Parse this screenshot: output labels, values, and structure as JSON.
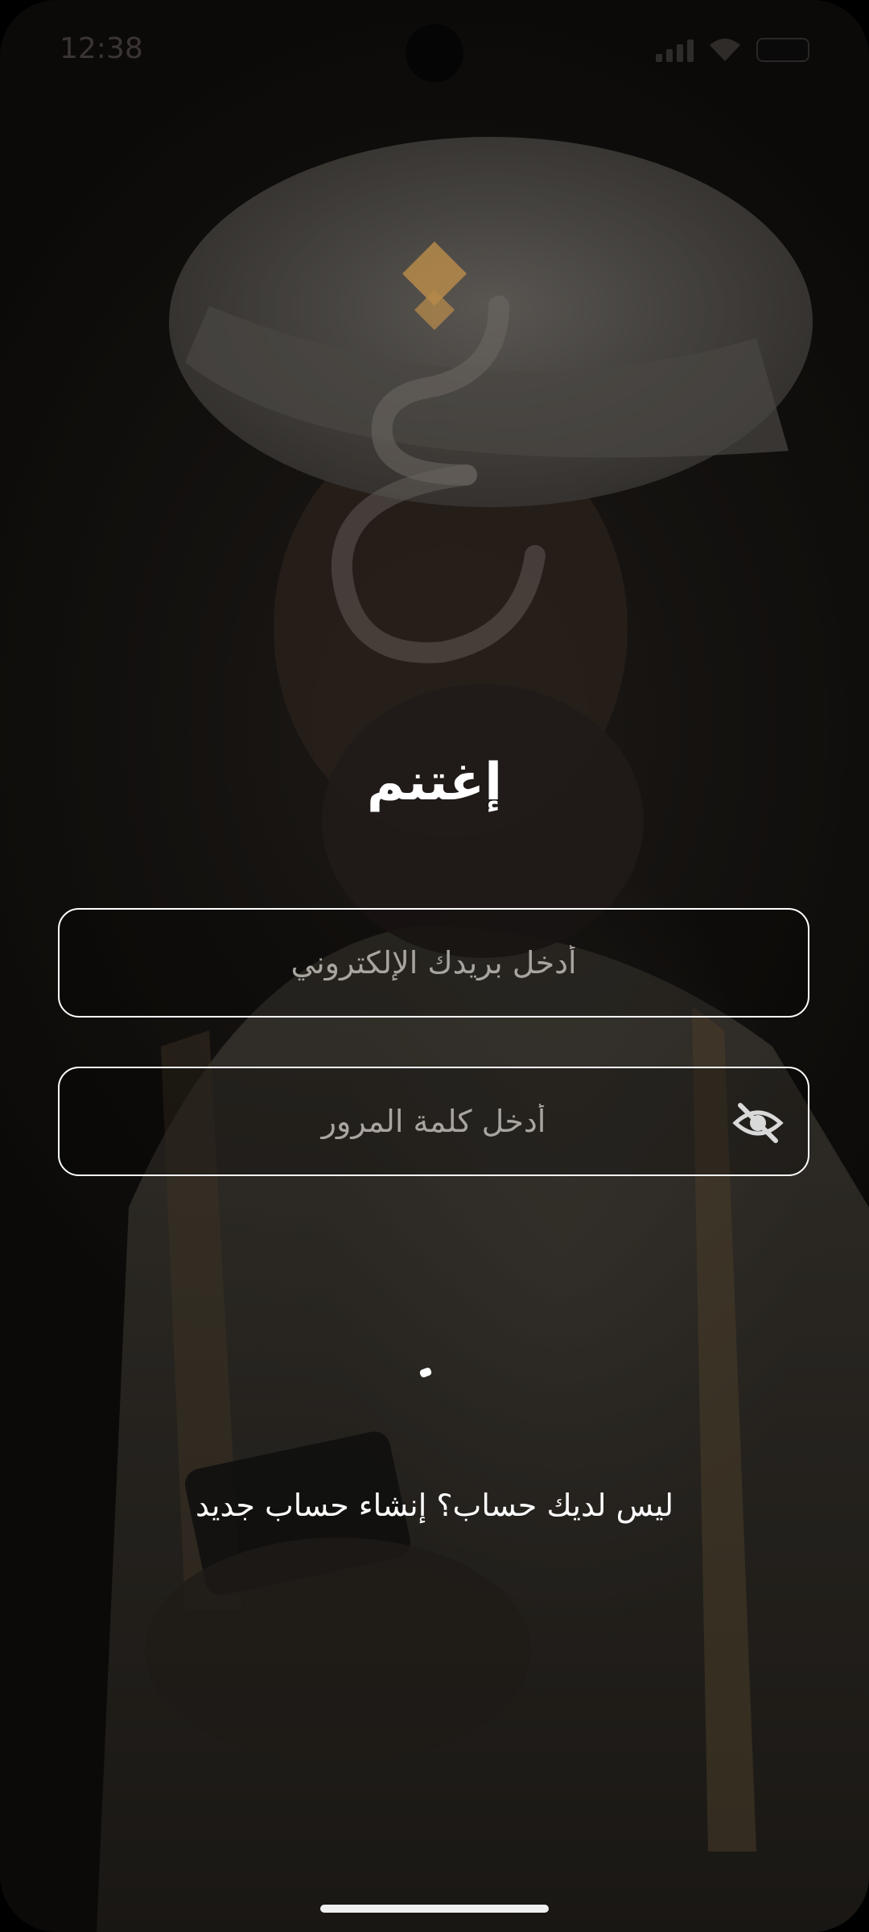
{
  "status_bar": {
    "time": "12:38",
    "icons": [
      "signal-icon",
      "wifi-icon",
      "battery-icon"
    ]
  },
  "logo": {
    "glyph": "غ",
    "accent_color": "#b68a4a"
  },
  "app": {
    "title": "إغتنم"
  },
  "form": {
    "email": {
      "placeholder": "أدخل بريدك الإلكتروني",
      "value": ""
    },
    "password": {
      "placeholder": "أدخل كلمة المرور",
      "value": "",
      "visibility_icon": "eye-off-icon"
    }
  },
  "signup": {
    "prompt": "ليس لديك حساب؟",
    "link_label": "إنشاء حساب جديد"
  },
  "colors": {
    "text": "#ffffff",
    "placeholder": "#a8a49f",
    "border": "#ffffff",
    "background": "#1c1816"
  }
}
